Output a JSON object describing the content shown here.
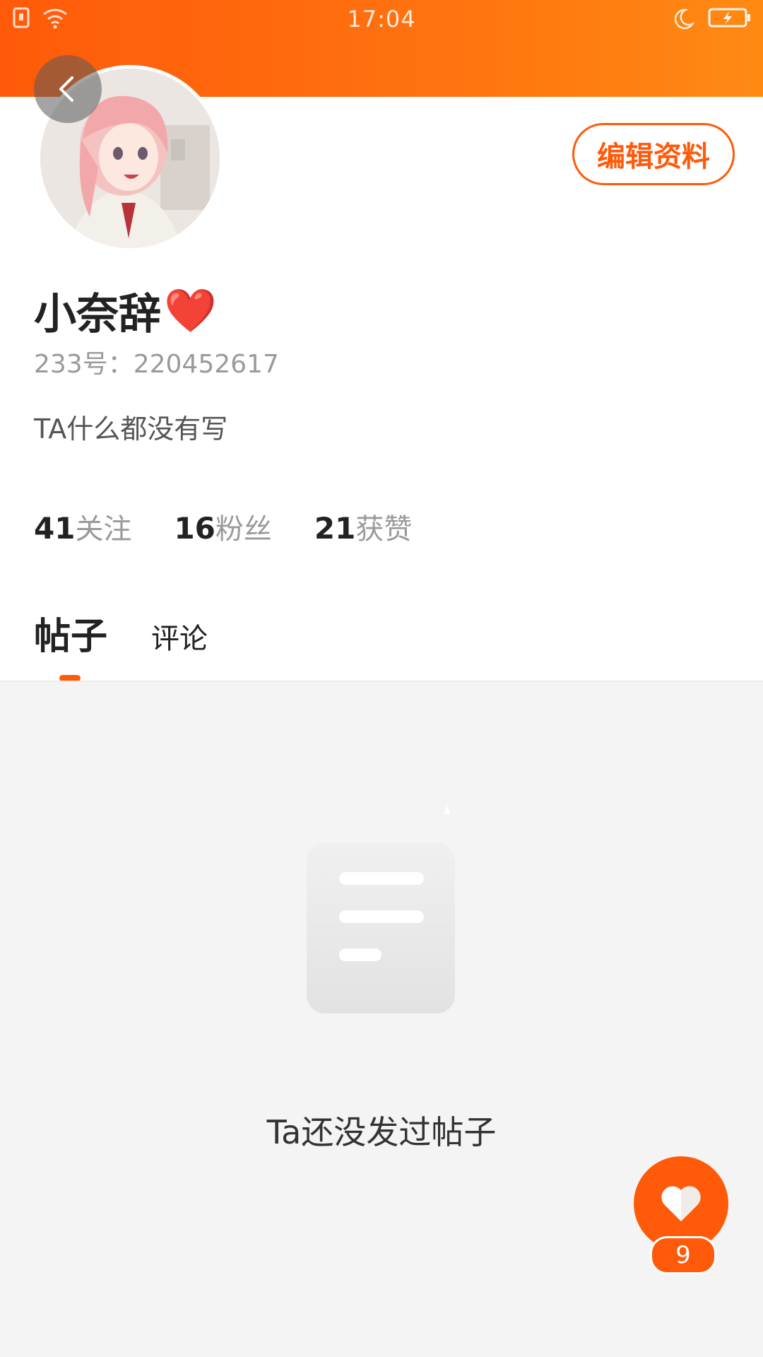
{
  "status_bar": {
    "time": "17:04",
    "icons": [
      "sim-icon",
      "wifi-icon",
      "moon-icon",
      "battery-charging-icon"
    ]
  },
  "header": {
    "back_icon": "chevron-left-icon",
    "edit_profile_label": "编辑资料"
  },
  "profile": {
    "nickname": "小奈辞",
    "nickname_emoji": "❤️",
    "uid_text": "233号：220452617",
    "bio": "TA什么都没有写"
  },
  "stats": [
    {
      "count": "41",
      "label": "关注"
    },
    {
      "count": "16",
      "label": "粉丝"
    },
    {
      "count": "21",
      "label": "获赞"
    }
  ],
  "tabs": [
    {
      "label": "帖子",
      "active": true
    },
    {
      "label": "评论",
      "active": false
    }
  ],
  "empty_state": {
    "icon": "document-icon",
    "text": "Ta还没发过帖子"
  },
  "like_button": {
    "icon": "heart-icon",
    "count": "9"
  },
  "colors": {
    "accent": "#ff5a0a",
    "header_gradient_end": "#ff8a12",
    "background": "#f4f4f4"
  }
}
